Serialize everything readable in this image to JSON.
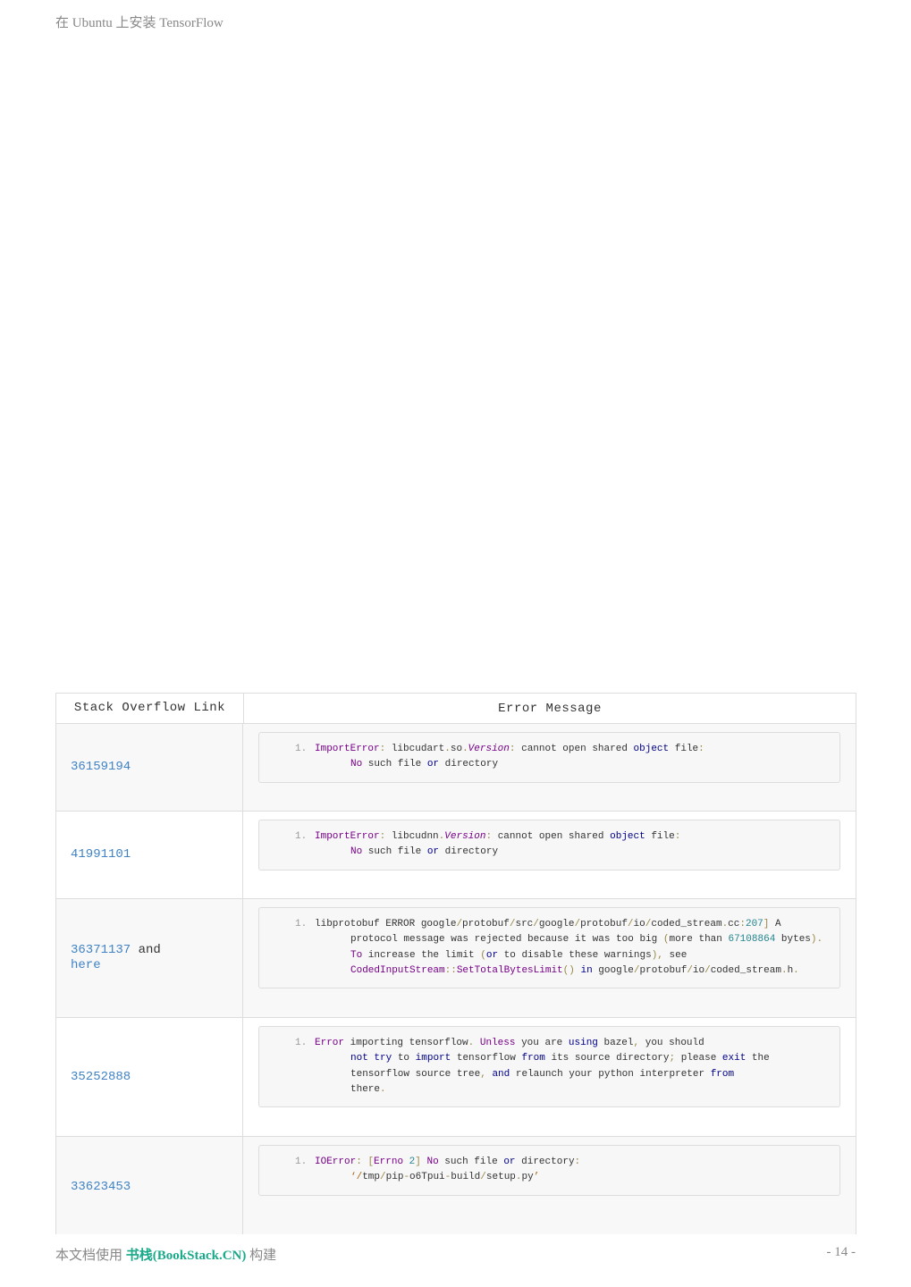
{
  "header": {
    "title": "在 Ubuntu 上安装 TensorFlow"
  },
  "table": {
    "headers": [
      "Stack Overflow Link",
      "Error Message"
    ],
    "rows": [
      {
        "link": "36159194",
        "extra": "",
        "link2": "",
        "height": 97,
        "alt": true,
        "code": [
          [
            [
              "ImportError",
              "kw"
            ],
            [
              ":",
              "pu"
            ],
            [
              " libcudart",
              ""
            ],
            [
              ".",
              "pu"
            ],
            [
              "so",
              ""
            ],
            [
              ".",
              "pu"
            ],
            [
              "Version",
              "it"
            ],
            [
              ":",
              "pu"
            ],
            [
              " cannot open shared ",
              ""
            ],
            [
              "object",
              "bl"
            ],
            [
              " file",
              ""
            ],
            [
              ":",
              "pu"
            ]
          ],
          [
            [
              "No",
              "kw"
            ],
            [
              " such file ",
              ""
            ],
            [
              "or",
              "bl"
            ],
            [
              " directory",
              ""
            ]
          ]
        ]
      },
      {
        "link": "41991101",
        "extra": "",
        "link2": "",
        "height": 97,
        "alt": false,
        "code": [
          [
            [
              "ImportError",
              "kw"
            ],
            [
              ":",
              "pu"
            ],
            [
              " libcudnn",
              ""
            ],
            [
              ".",
              "pu"
            ],
            [
              "Version",
              "it"
            ],
            [
              ":",
              "pu"
            ],
            [
              " cannot open shared ",
              ""
            ],
            [
              "object",
              "bl"
            ],
            [
              " file",
              ""
            ],
            [
              ":",
              "pu"
            ]
          ],
          [
            [
              "No",
              "kw"
            ],
            [
              " such file ",
              ""
            ],
            [
              "or",
              "bl"
            ],
            [
              " directory",
              ""
            ]
          ]
        ]
      },
      {
        "link": "36371137",
        "extra": " and",
        "link2": "here",
        "height": 132,
        "alt": true,
        "code": [
          [
            [
              "libprotobuf ERROR google",
              ""
            ],
            [
              "/",
              "pu"
            ],
            [
              "protobuf",
              ""
            ],
            [
              "/",
              "pu"
            ],
            [
              "src",
              ""
            ],
            [
              "/",
              "pu"
            ],
            [
              "google",
              ""
            ],
            [
              "/",
              "pu"
            ],
            [
              "protobuf",
              ""
            ],
            [
              "/",
              "pu"
            ],
            [
              "io",
              ""
            ],
            [
              "/",
              "pu"
            ],
            [
              "coded_stream",
              ""
            ],
            [
              ".",
              "pu"
            ],
            [
              "cc",
              ""
            ],
            [
              ":",
              "pu"
            ],
            [
              "207",
              "nu"
            ],
            [
              "]",
              "pu"
            ],
            [
              " A",
              ""
            ]
          ],
          [
            [
              "protocol message was rejected because it was too big ",
              ""
            ],
            [
              "(",
              "pu"
            ],
            [
              "more than ",
              ""
            ],
            [
              "67108864",
              "nu"
            ],
            [
              " bytes",
              ""
            ],
            [
              ").",
              "pu"
            ]
          ],
          [
            [
              "To",
              "kw"
            ],
            [
              " increase the limit ",
              ""
            ],
            [
              "(",
              "pu"
            ],
            [
              "or",
              "bl"
            ],
            [
              " to disable these warnings",
              ""
            ],
            [
              "),",
              "pu"
            ],
            [
              " see",
              ""
            ]
          ],
          [
            [
              "CodedInputStream",
              "kw"
            ],
            [
              "::",
              "pu"
            ],
            [
              "SetTotalBytesLimit",
              "kw"
            ],
            [
              "()",
              "pu"
            ],
            [
              " ",
              ""
            ],
            [
              "in",
              "bl"
            ],
            [
              " google",
              ""
            ],
            [
              "/",
              "pu"
            ],
            [
              "protobuf",
              ""
            ],
            [
              "/",
              "pu"
            ],
            [
              "io",
              ""
            ],
            [
              "/",
              "pu"
            ],
            [
              "coded_stream",
              ""
            ],
            [
              ".",
              "pu"
            ],
            [
              "h",
              ""
            ],
            [
              ".",
              "pu"
            ]
          ]
        ]
      },
      {
        "link": "35252888",
        "extra": "",
        "link2": "",
        "height": 132,
        "alt": false,
        "code": [
          [
            [
              "Error",
              "kw"
            ],
            [
              " importing tensorflow",
              ""
            ],
            [
              ".",
              "pu"
            ],
            [
              " ",
              ""
            ],
            [
              "Unless",
              "kw"
            ],
            [
              " you are ",
              ""
            ],
            [
              "using",
              "bl"
            ],
            [
              " bazel",
              ""
            ],
            [
              ",",
              "pu"
            ],
            [
              " you should",
              ""
            ]
          ],
          [
            [
              "not",
              "bl"
            ],
            [
              " ",
              ""
            ],
            [
              "try",
              "bl"
            ],
            [
              " to ",
              ""
            ],
            [
              "import",
              "bl"
            ],
            [
              " tensorflow ",
              ""
            ],
            [
              "from",
              "bl"
            ],
            [
              " its source directory",
              ""
            ],
            [
              ";",
              "pu"
            ],
            [
              " please ",
              ""
            ],
            [
              "exit",
              "bl"
            ],
            [
              " the",
              ""
            ]
          ],
          [
            [
              "tensorflow source tree",
              ""
            ],
            [
              ",",
              "pu"
            ],
            [
              " ",
              ""
            ],
            [
              "and",
              "bl"
            ],
            [
              " relaunch your python interpreter ",
              ""
            ],
            [
              "from",
              "bl"
            ]
          ],
          [
            [
              "there",
              ""
            ],
            [
              ".",
              "pu"
            ]
          ]
        ]
      },
      {
        "link": "33623453",
        "extra": "",
        "link2": "",
        "height": 113,
        "alt": true,
        "code": [
          [
            [
              "IOError",
              "kw"
            ],
            [
              ":",
              "pu"
            ],
            [
              " ",
              ""
            ],
            [
              "[",
              "pu"
            ],
            [
              "Errno",
              "kw"
            ],
            [
              " ",
              ""
            ],
            [
              "2",
              "nu"
            ],
            [
              "]",
              "pu"
            ],
            [
              " ",
              ""
            ],
            [
              "No",
              "kw"
            ],
            [
              " such file ",
              ""
            ],
            [
              "or",
              "bl"
            ],
            [
              " directory",
              ""
            ],
            [
              ":",
              "pu"
            ]
          ],
          [
            [
              "‘/",
              "st"
            ],
            [
              "tmp",
              ""
            ],
            [
              "/",
              "pu"
            ],
            [
              "pip",
              ""
            ],
            [
              "-",
              "pu"
            ],
            [
              "o6Tpui",
              ""
            ],
            [
              "-",
              "pu"
            ],
            [
              "build",
              ""
            ],
            [
              "/",
              "pu"
            ],
            [
              "setup",
              ""
            ],
            [
              ".",
              "pu"
            ],
            [
              "py",
              ""
            ],
            [
              "’",
              "st"
            ]
          ]
        ]
      }
    ]
  },
  "footer": {
    "prefix": "本文档使用 ",
    "brand": "书栈(BookStack.CN)",
    "suffix": " 构建",
    "page": "- 14 -"
  }
}
